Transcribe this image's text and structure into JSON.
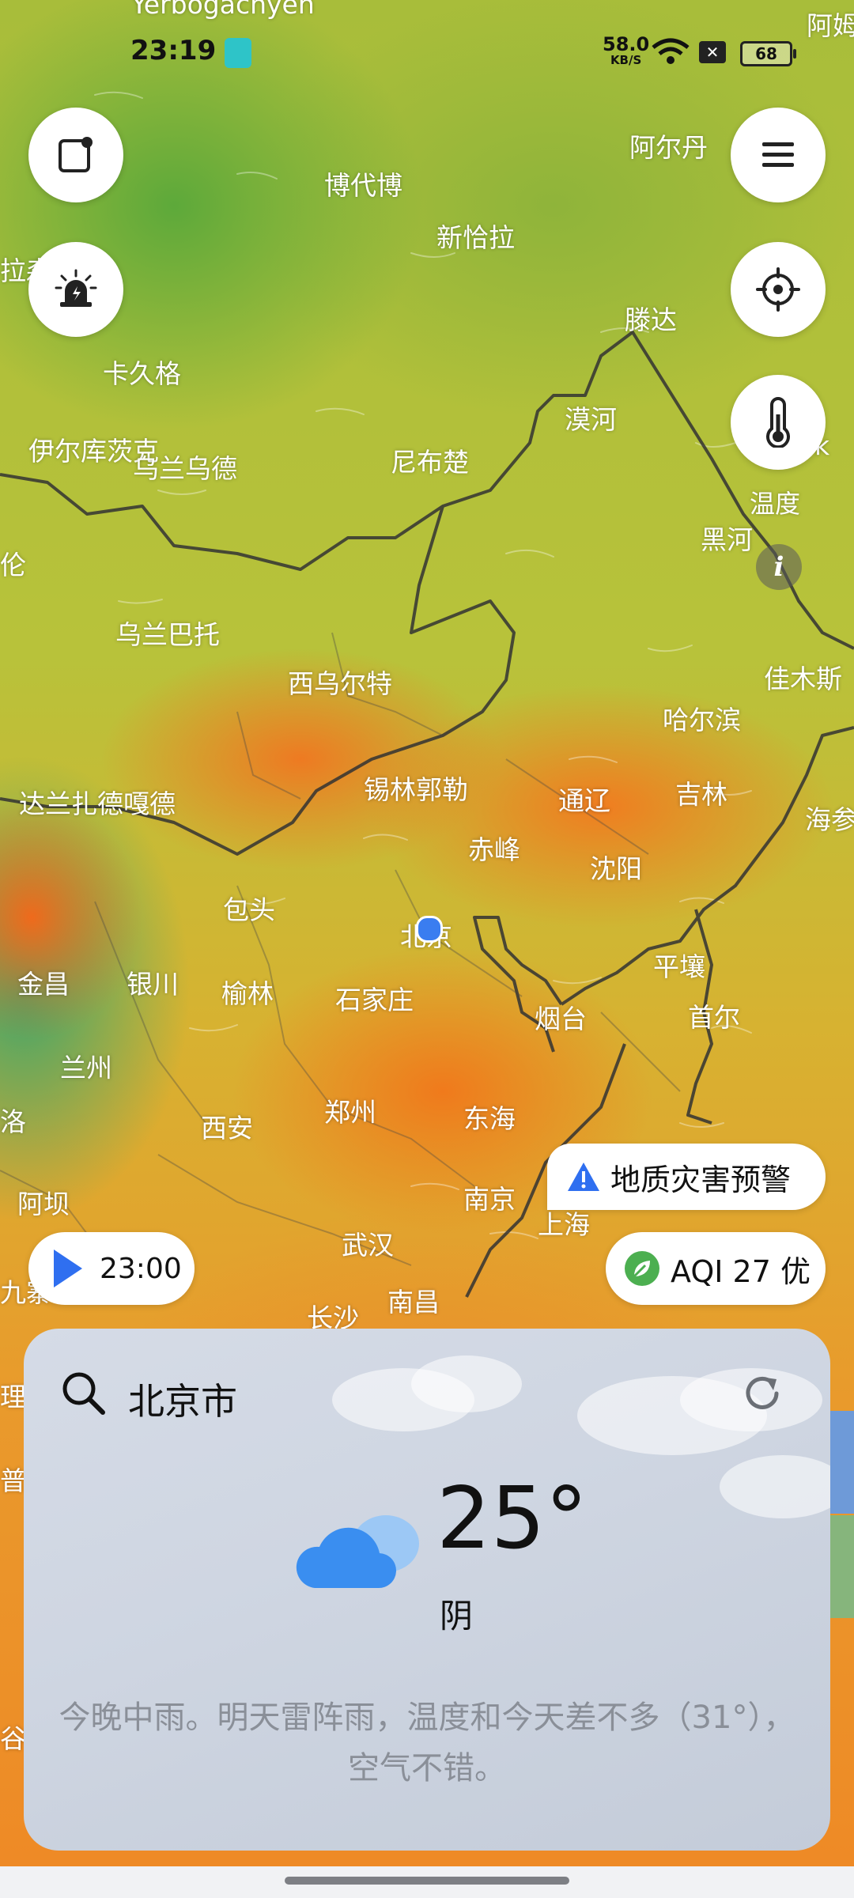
{
  "status_bar": {
    "time": "23:19",
    "net_speed": "58.0",
    "net_unit": "KB/S",
    "battery": "68"
  },
  "map": {
    "top_edge_text": "Yerbogachyen",
    "top_right_text": "阿姆",
    "cities": [
      {
        "name": "阿尔丹"
      },
      {
        "name": "博代博"
      },
      {
        "name": "新恰拉"
      },
      {
        "name": "拉森"
      },
      {
        "name": "滕达"
      },
      {
        "name": "卡久格"
      },
      {
        "name": "漠河"
      },
      {
        "name": "伊尔库茨克"
      },
      {
        "name": "乌兰乌德"
      },
      {
        "name": "尼布楚"
      },
      {
        "name": "黑河"
      },
      {
        "name": "k"
      },
      {
        "name": "伦"
      },
      {
        "name": "乌兰巴托"
      },
      {
        "name": "佳木斯"
      },
      {
        "name": "西乌尔特"
      },
      {
        "name": "哈尔滨"
      },
      {
        "name": "锡林郭勒"
      },
      {
        "name": "达兰扎德嘎德"
      },
      {
        "name": "通辽"
      },
      {
        "name": "吉林"
      },
      {
        "name": "海参"
      },
      {
        "name": "赤峰"
      },
      {
        "name": "沈阳"
      },
      {
        "name": "包头"
      },
      {
        "name": "北京"
      },
      {
        "name": "平壤"
      },
      {
        "name": "金昌"
      },
      {
        "name": "银川"
      },
      {
        "name": "榆林"
      },
      {
        "name": "石家庄"
      },
      {
        "name": "烟台"
      },
      {
        "name": "首尔"
      },
      {
        "name": "兰州"
      },
      {
        "name": "郑州"
      },
      {
        "name": "东海"
      },
      {
        "name": "西安"
      },
      {
        "name": "洛"
      },
      {
        "name": "阿坝"
      },
      {
        "name": "南京"
      },
      {
        "name": "上海"
      },
      {
        "name": "武汉"
      },
      {
        "name": "九寨"
      },
      {
        "name": "南昌"
      },
      {
        "name": "长沙"
      },
      {
        "name": "理"
      },
      {
        "name": "普洱"
      },
      {
        "name": "谷"
      }
    ]
  },
  "controls": {
    "layer_label": "温度",
    "info_glyph": "i",
    "playback_time": "23:00",
    "alert_label": "地质灾害预警",
    "aqi_label": "AQI 27 优"
  },
  "weather_card": {
    "city": "北京市",
    "temperature": "25°",
    "condition": "阴",
    "summary": "今晚中雨。明天雷阵雨，温度和今天差不多（31°），空气不错。"
  },
  "icons": {
    "top_left_1": "note-edit-icon",
    "top_left_2": "alarm-siren-icon",
    "top_right_1": "menu-icon",
    "top_right_2": "locate-icon",
    "top_right_3": "thermometer-icon",
    "play": "play-icon",
    "alert": "warning-icon",
    "aqi": "leaf-icon",
    "search": "search-icon",
    "refresh": "refresh-icon",
    "weather": "cloudy-icon"
  },
  "colors": {
    "play_blue": "#2f6ff0",
    "warning_blue": "#2f6ff0",
    "leaf_green": "#4caf50",
    "cloud_blue": "#3a8ef0"
  }
}
